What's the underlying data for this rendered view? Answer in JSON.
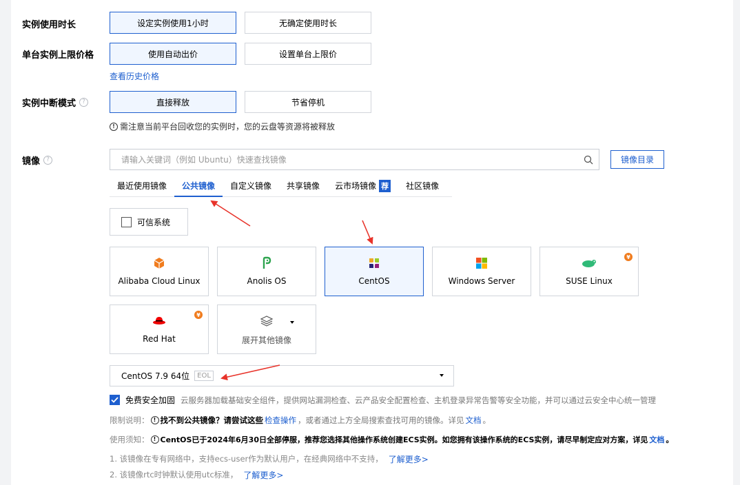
{
  "duration": {
    "label": "实例使用时长",
    "options": [
      "设定实例使用1小时",
      "无确定使用时长"
    ],
    "selected": 0
  },
  "price_limit": {
    "label": "单台实例上限价格",
    "options": [
      "使用自动出价",
      "设置单台上限价"
    ],
    "selected": 0,
    "history_link": "查看历史价格"
  },
  "interrupt": {
    "label": "实例中断模式",
    "options": [
      "直接释放",
      "节省停机"
    ],
    "selected": 0,
    "note": "需注意当前平台回收您的实例时，您的云盘等资源将被释放"
  },
  "image": {
    "label": "镜像",
    "search_placeholder": "请输入关键词（例如 Ubuntu）快速查找镜像",
    "catalog_button": "镜像目录",
    "tabs": [
      "最近使用镜像",
      "公共镜像",
      "自定义镜像",
      "共享镜像",
      "云市场镜像",
      "社区镜像"
    ],
    "tab_badge": "荐",
    "active_tab": 1,
    "trusted_label": "可信系统",
    "cards": [
      {
        "label": "Alibaba Cloud Linux",
        "icon": "alibaba-cloud-linux-icon",
        "paid": false
      },
      {
        "label": "Anolis OS",
        "icon": "anolis-os-icon",
        "paid": false
      },
      {
        "label": "CentOS",
        "icon": "centos-icon",
        "paid": false,
        "selected": true
      },
      {
        "label": "Windows Server",
        "icon": "windows-icon",
        "paid": false
      },
      {
        "label": "SUSE Linux",
        "icon": "suse-icon",
        "paid": true
      },
      {
        "label": "Red Hat",
        "icon": "redhat-icon",
        "paid": true
      },
      {
        "label": "展开其他镜像",
        "icon": "layers-icon",
        "paid": false
      }
    ],
    "paid_badge": "¥",
    "version": "CentOS 7.9 64位",
    "version_tag": "EOL",
    "security": {
      "label": "免费安全加固",
      "desc": "云服务器加载基础安全组件，提供网站漏洞检查、云产品安全配置检查、主机登录异常告警等安全功能，并可以通过云安全中心统一管理"
    },
    "limit": {
      "title": "限制说明：",
      "bold": "找不到公共镜像？请尝试这些",
      "link": "检查操作",
      "rest": "，或者通过上方全局搜索查找可用的镜像。详见",
      "doc_link": "文档",
      "end": "。"
    },
    "notice": {
      "title": "使用须知：",
      "bold": "CentOS已于2024年6月30日全部停服，推荐您选择其他操作系统创建ECS实例。如您拥有该操作系统的ECS实例，请尽早制定应对方案，详见",
      "doc_link": "文档",
      "end": "。"
    },
    "footnotes": [
      {
        "text": "1. 该镜像在专有网络中，支持ecs-user作为默认用户，在经典网络中不支持，",
        "link": "了解更多>"
      },
      {
        "text": "2. 该镜像rtc时钟默认使用utc标准，",
        "link": "了解更多>"
      }
    ]
  },
  "colors": {
    "accent": "#1e5fcf",
    "annotation_arrow": "#e8332a",
    "paid_badge": "#f07c1e"
  }
}
